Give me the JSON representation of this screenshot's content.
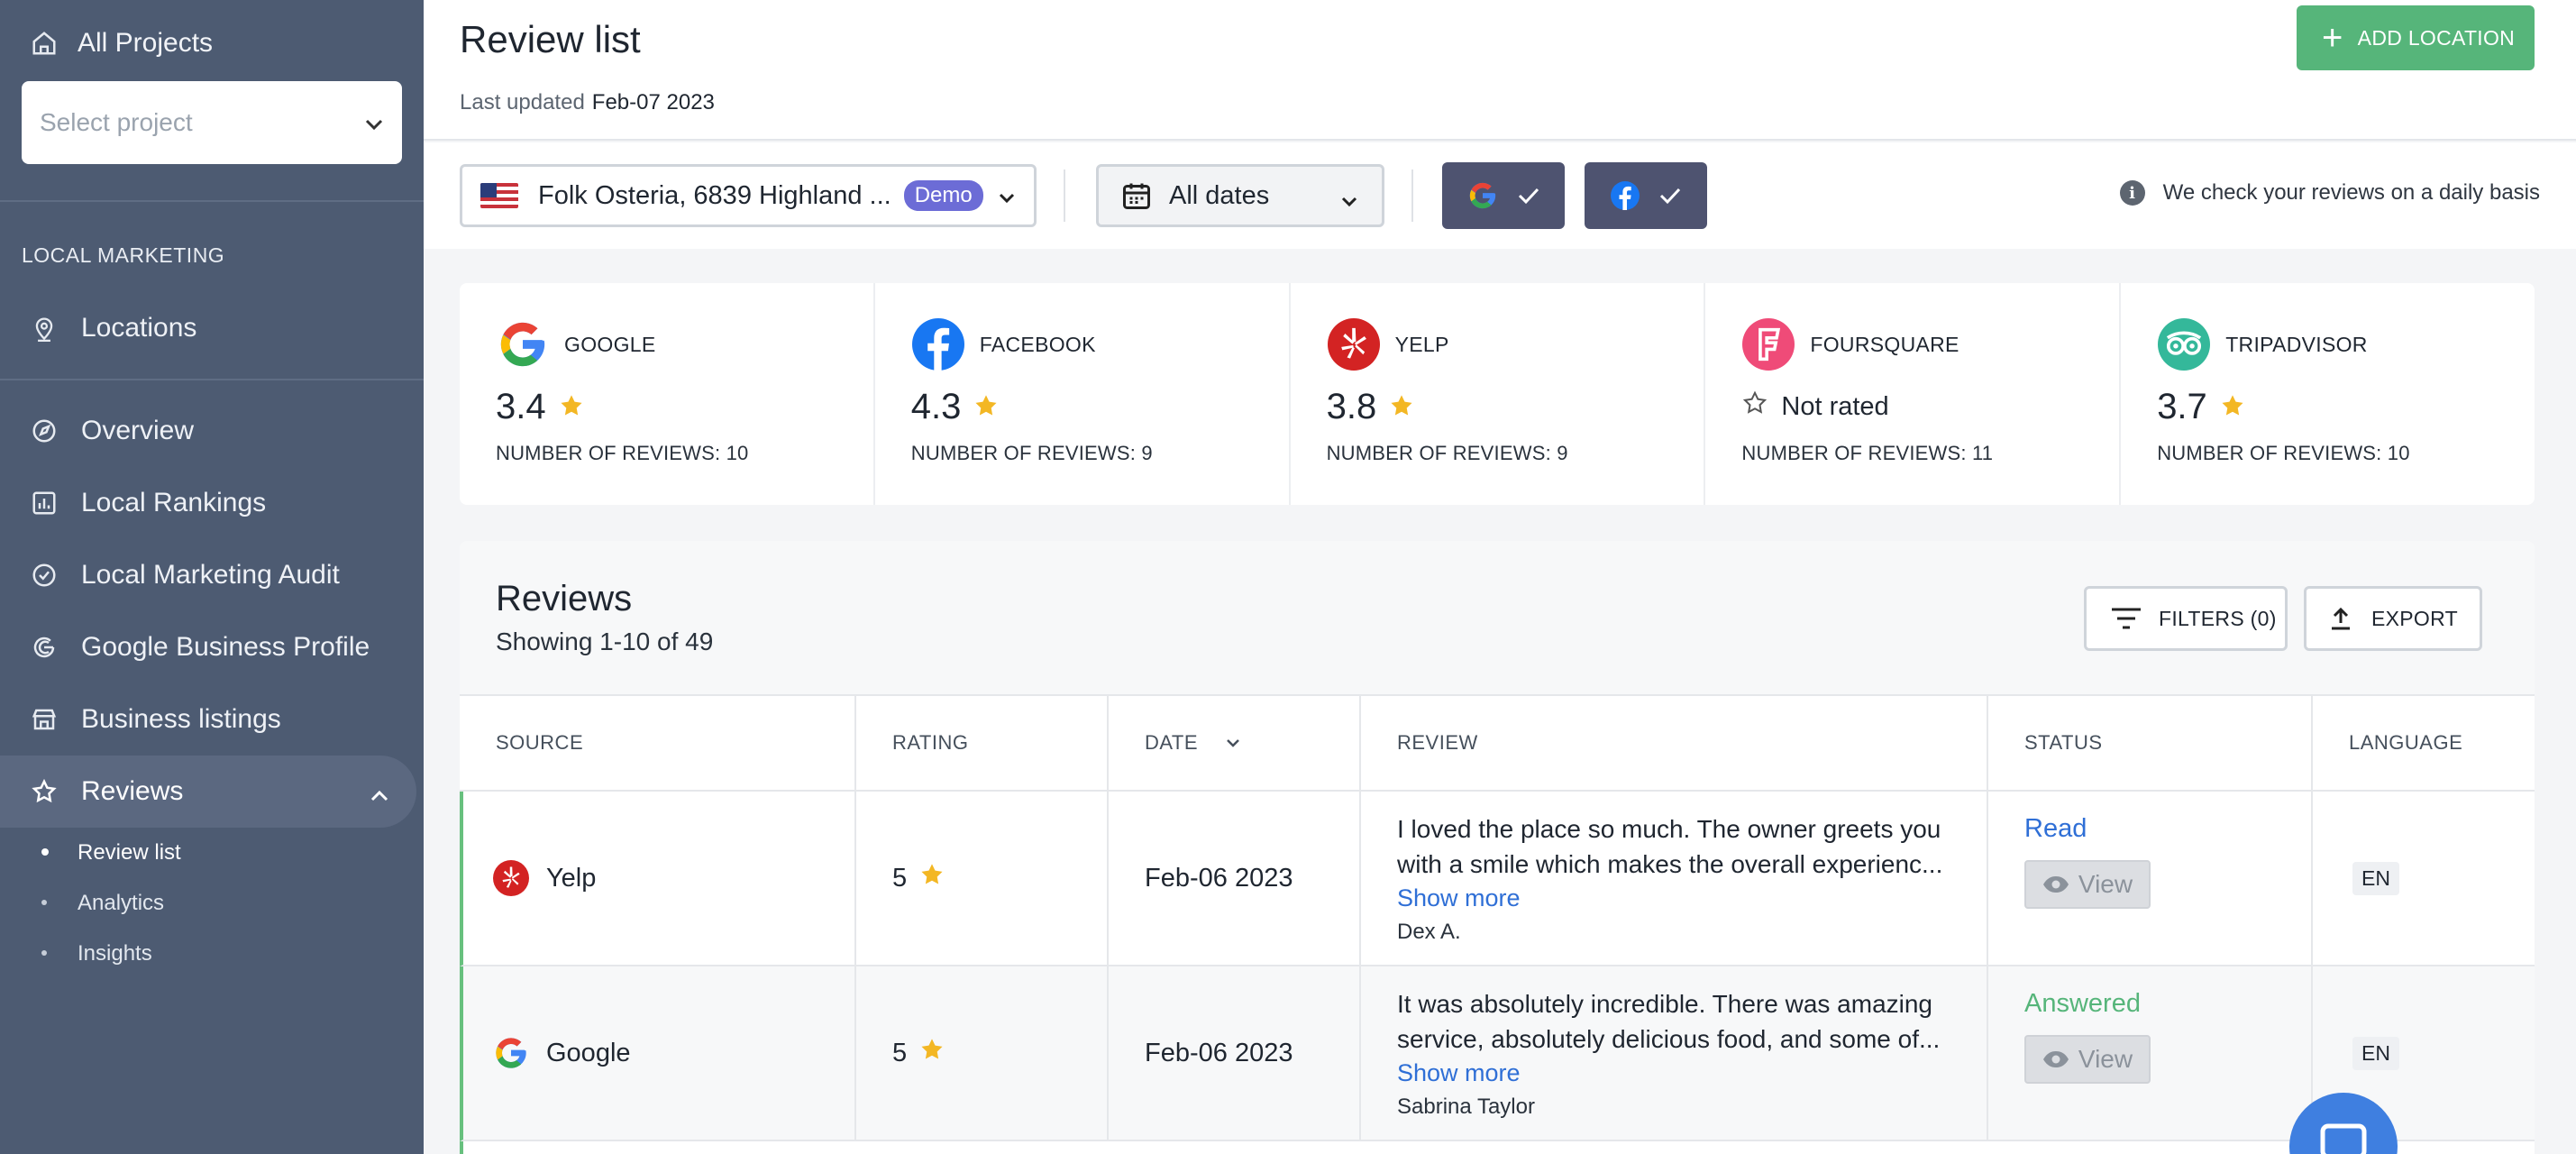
{
  "sidebar": {
    "all_projects": "All Projects",
    "select_project_placeholder": "Select project",
    "section_label": "LOCAL MARKETING",
    "locations": "Locations",
    "items": [
      {
        "label": "Overview",
        "icon": "compass-icon"
      },
      {
        "label": "Local Rankings",
        "icon": "bar-chart-icon"
      },
      {
        "label": "Local Marketing Audit",
        "icon": "check-circle-icon"
      },
      {
        "label": "Google Business Profile",
        "icon": "google-outline-icon"
      },
      {
        "label": "Business listings",
        "icon": "storefront-icon"
      },
      {
        "label": "Reviews",
        "icon": "star-outline-icon"
      }
    ],
    "sub_items": [
      {
        "label": "Review list",
        "active": true
      },
      {
        "label": "Analytics"
      },
      {
        "label": "Insights"
      }
    ]
  },
  "header": {
    "title": "Review list",
    "last_updated_label": "Last updated",
    "last_updated_value": "Feb-07 2023",
    "add_location": "ADD LOCATION"
  },
  "toolbar": {
    "location": "Folk Osteria, 6839 Highland ...",
    "demo_badge": "Demo",
    "dates": "All dates",
    "daily_info": "We check your reviews on a daily basis"
  },
  "cards": [
    {
      "name": "GOOGLE",
      "rating": "3.4",
      "count_label": "NUMBER OF REVIEWS: 10"
    },
    {
      "name": "FACEBOOK",
      "rating": "4.3",
      "count_label": "NUMBER OF REVIEWS: 9"
    },
    {
      "name": "YELP",
      "rating": "3.8",
      "count_label": "NUMBER OF REVIEWS: 9"
    },
    {
      "name": "FOURSQUARE",
      "rating": "Not rated",
      "count_label": "NUMBER OF REVIEWS: 11"
    },
    {
      "name": "TRIPADVISOR",
      "rating": "3.7",
      "count_label": "NUMBER OF REVIEWS: 10"
    }
  ],
  "reviews": {
    "title": "Reviews",
    "showing": "Showing 1-10 of 49",
    "filters": "FILTERS (0)",
    "export": "EXPORT",
    "columns": [
      "SOURCE",
      "RATING",
      "DATE",
      "REVIEW",
      "STATUS",
      "LANGUAGE"
    ],
    "rows": [
      {
        "source": "Yelp",
        "rating": "5",
        "date": "Feb-06 2023",
        "review": "I loved the place so much. The owner greets you with a smile which makes the overall experienc...",
        "show_more": "Show more",
        "author": "Dex A.",
        "status": "Read",
        "view": "View",
        "language": "EN"
      },
      {
        "source": "Google",
        "rating": "5",
        "date": "Feb-06 2023",
        "review": "It was absolutely incredible. There was amazing service, absolutely delicious food, and some of...",
        "show_more": "Show more",
        "author": "Sabrina Taylor",
        "status": "Answered",
        "view": "View",
        "language": "EN"
      }
    ]
  },
  "colors": {
    "sidebar_bg": "#4d5b72",
    "accent_green": "#56b57a",
    "link_blue": "#2f6fd6",
    "star_gold": "#f3b724",
    "toggle_bg": "#4e5370"
  }
}
